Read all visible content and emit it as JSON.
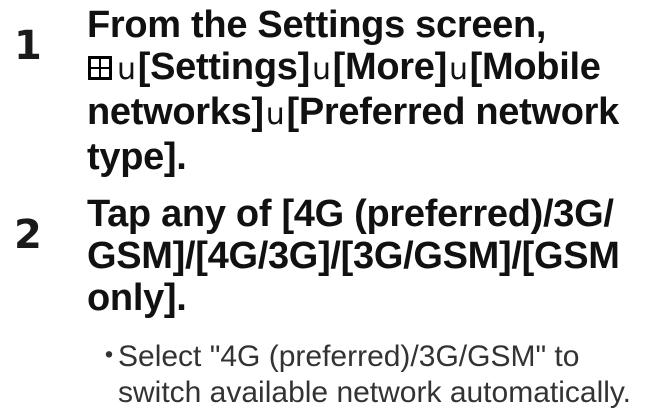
{
  "steps": [
    {
      "number": "1",
      "lines": {
        "l1": "From the Settings screen,",
        "l2_sep1": "u",
        "l2_item1": "[Settings]",
        "l2_sep2": "u",
        "l2_item2": "[More]",
        "l2_sep3": "u",
        "l2_item3": "[Mobile",
        "l3_a": "networks]",
        "l3_sep": "u",
        "l3_b": "[Preferred network",
        "l4": "type]."
      }
    },
    {
      "number": "2",
      "lines": {
        "l1": "Tap any of [4G (preferred)/3G/",
        "l2": "GSM]/[4G/3G]/[3G/GSM]/[GSM",
        "l3": "only]."
      },
      "note": {
        "bullet": "・",
        "l1": "Select \"4G (preferred)/3G/GSM\" to",
        "l2": "switch available network automatically."
      }
    }
  ],
  "icons": {
    "apps_icon": "apps-grid-icon"
  },
  "colors": {
    "text": "#111111",
    "note_text": "#333333"
  }
}
